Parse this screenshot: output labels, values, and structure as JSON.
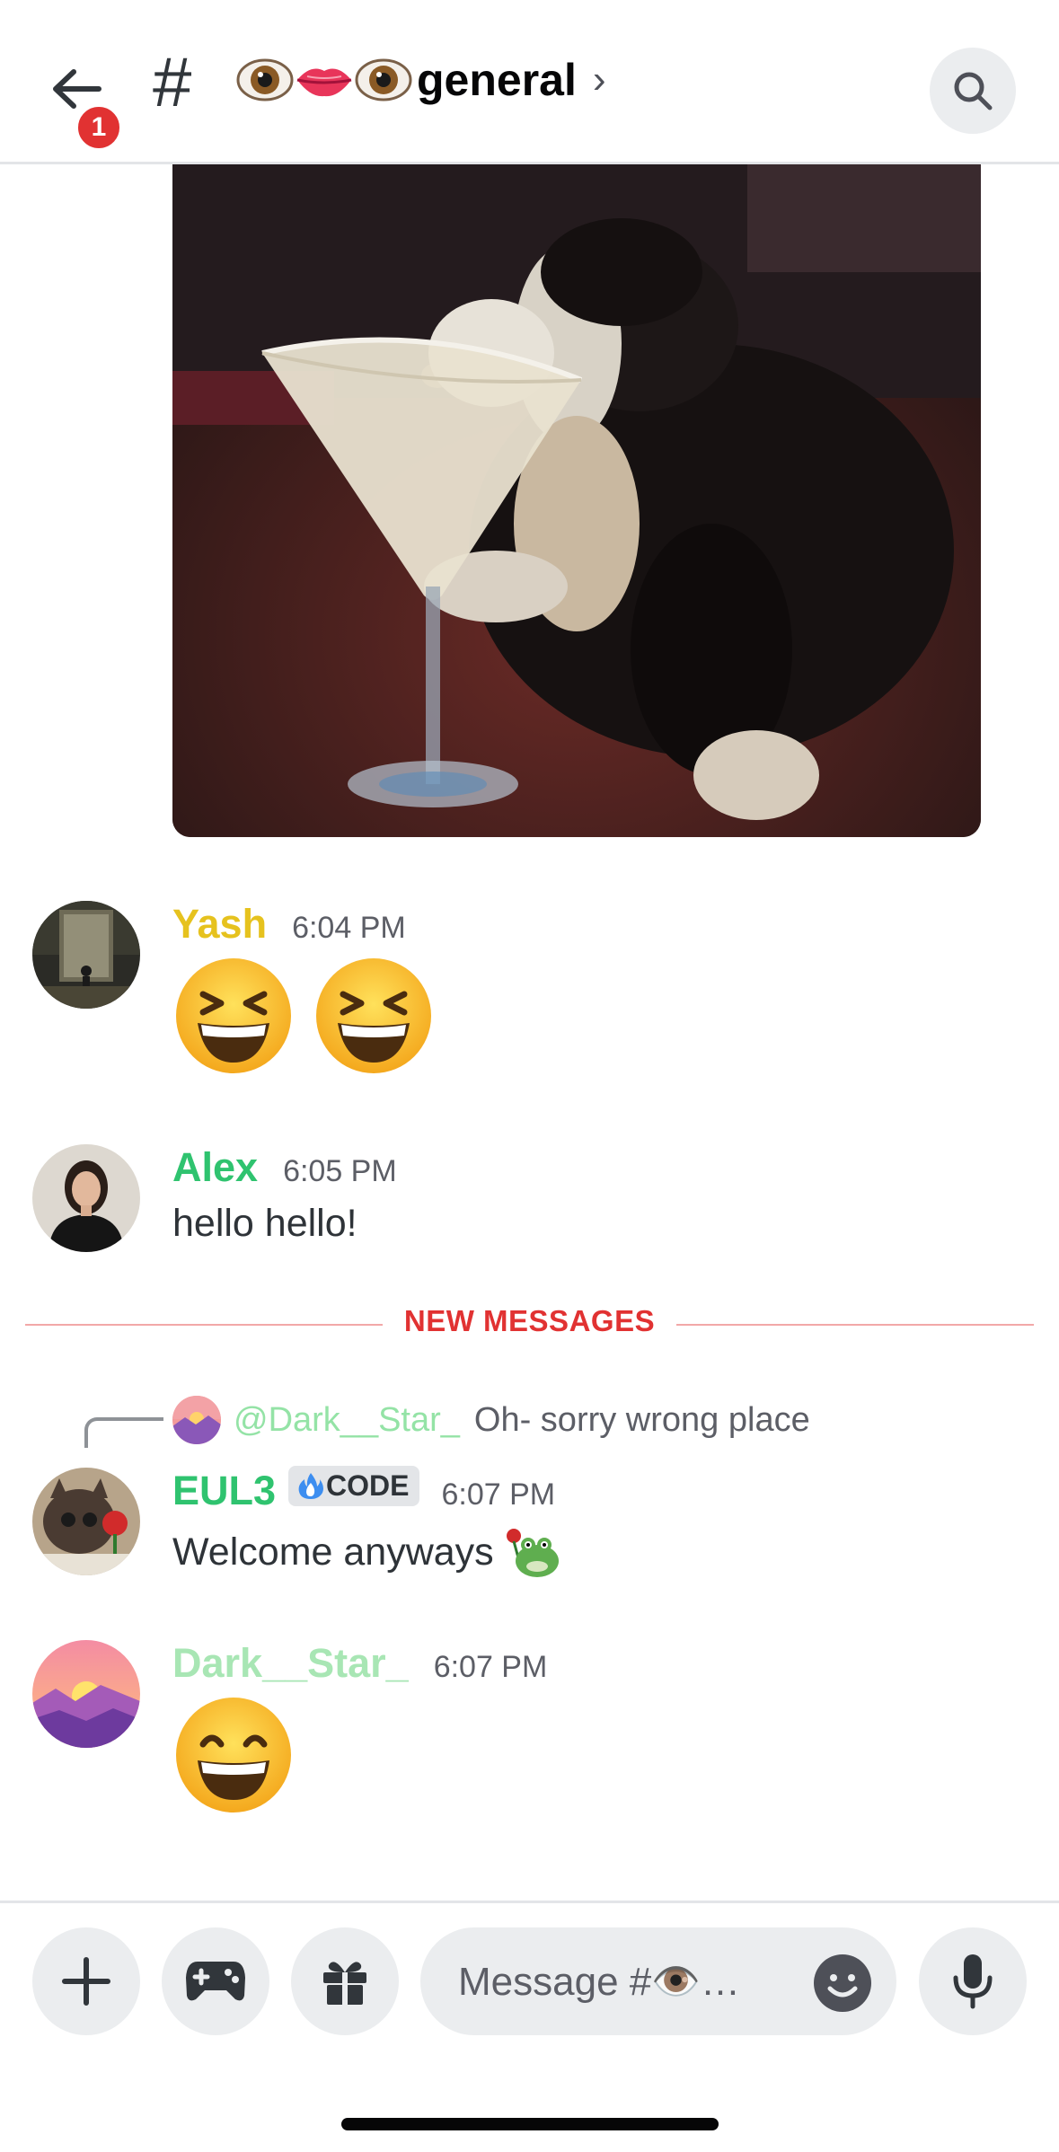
{
  "header": {
    "back_badge_count": "1",
    "hash_symbol": "#",
    "channel_emoji": [
      "eye-emoji",
      "lips-emoji",
      "eye-emoji"
    ],
    "channel_name": "general",
    "chevron": "›"
  },
  "messages": [
    {
      "author": "Yash",
      "author_color": "#e6c21e",
      "time": "6:04 PM",
      "emojis": [
        "grinning-squinting-face",
        "grinning-squinting-face"
      ]
    },
    {
      "author": "Alex",
      "author_color": "#2fc36f",
      "time": "6:05 PM",
      "text": "hello hello!"
    },
    {
      "reply_to_user": "@Dark__Star_",
      "reply_to_text": "Oh- sorry wrong place",
      "author": "EUL3",
      "author_color": "#2fc36f",
      "tag": "CODE",
      "time": "6:07 PM",
      "text": "Welcome anyways"
    },
    {
      "author": "Dark__Star_",
      "author_color": "#a8e6b4",
      "time": "6:07 PM",
      "emojis": [
        "beaming-face"
      ]
    }
  ],
  "divider": {
    "label": "NEW MESSAGES"
  },
  "composer": {
    "placeholder": "Message #👁️…"
  },
  "colors": {
    "badge": "#e13232",
    "divider": "#e13232",
    "reply_user": "#94e3a6"
  }
}
